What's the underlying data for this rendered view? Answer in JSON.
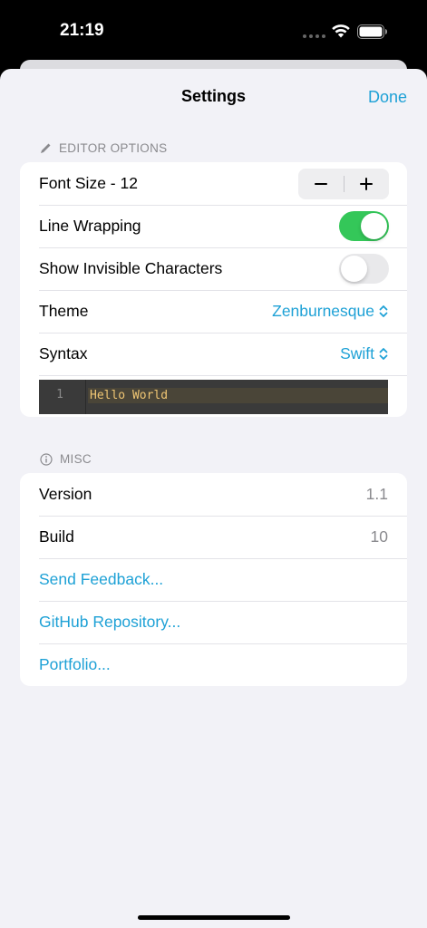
{
  "status": {
    "time": "21:19"
  },
  "nav": {
    "title": "Settings",
    "done_label": "Done"
  },
  "editor": {
    "header": "EDITOR OPTIONS",
    "font_size_label": "Font Size - 12",
    "line_wrapping_label": "Line Wrapping",
    "line_wrapping_on": true,
    "invisible_label": "Show Invisible Characters",
    "invisible_on": false,
    "theme_label": "Theme",
    "theme_value": "Zenburnesque",
    "syntax_label": "Syntax",
    "syntax_value": "Swift",
    "preview": {
      "line_number": "1",
      "code": "Hello World"
    }
  },
  "misc": {
    "header": "MISC",
    "version_label": "Version",
    "version_value": "1.1",
    "build_label": "Build",
    "build_value": "10",
    "feedback_label": "Send Feedback...",
    "github_label": "GitHub Repository...",
    "portfolio_label": "Portfolio..."
  },
  "colors": {
    "accent": "#1ea1d6",
    "toggle_on": "#34c759"
  }
}
